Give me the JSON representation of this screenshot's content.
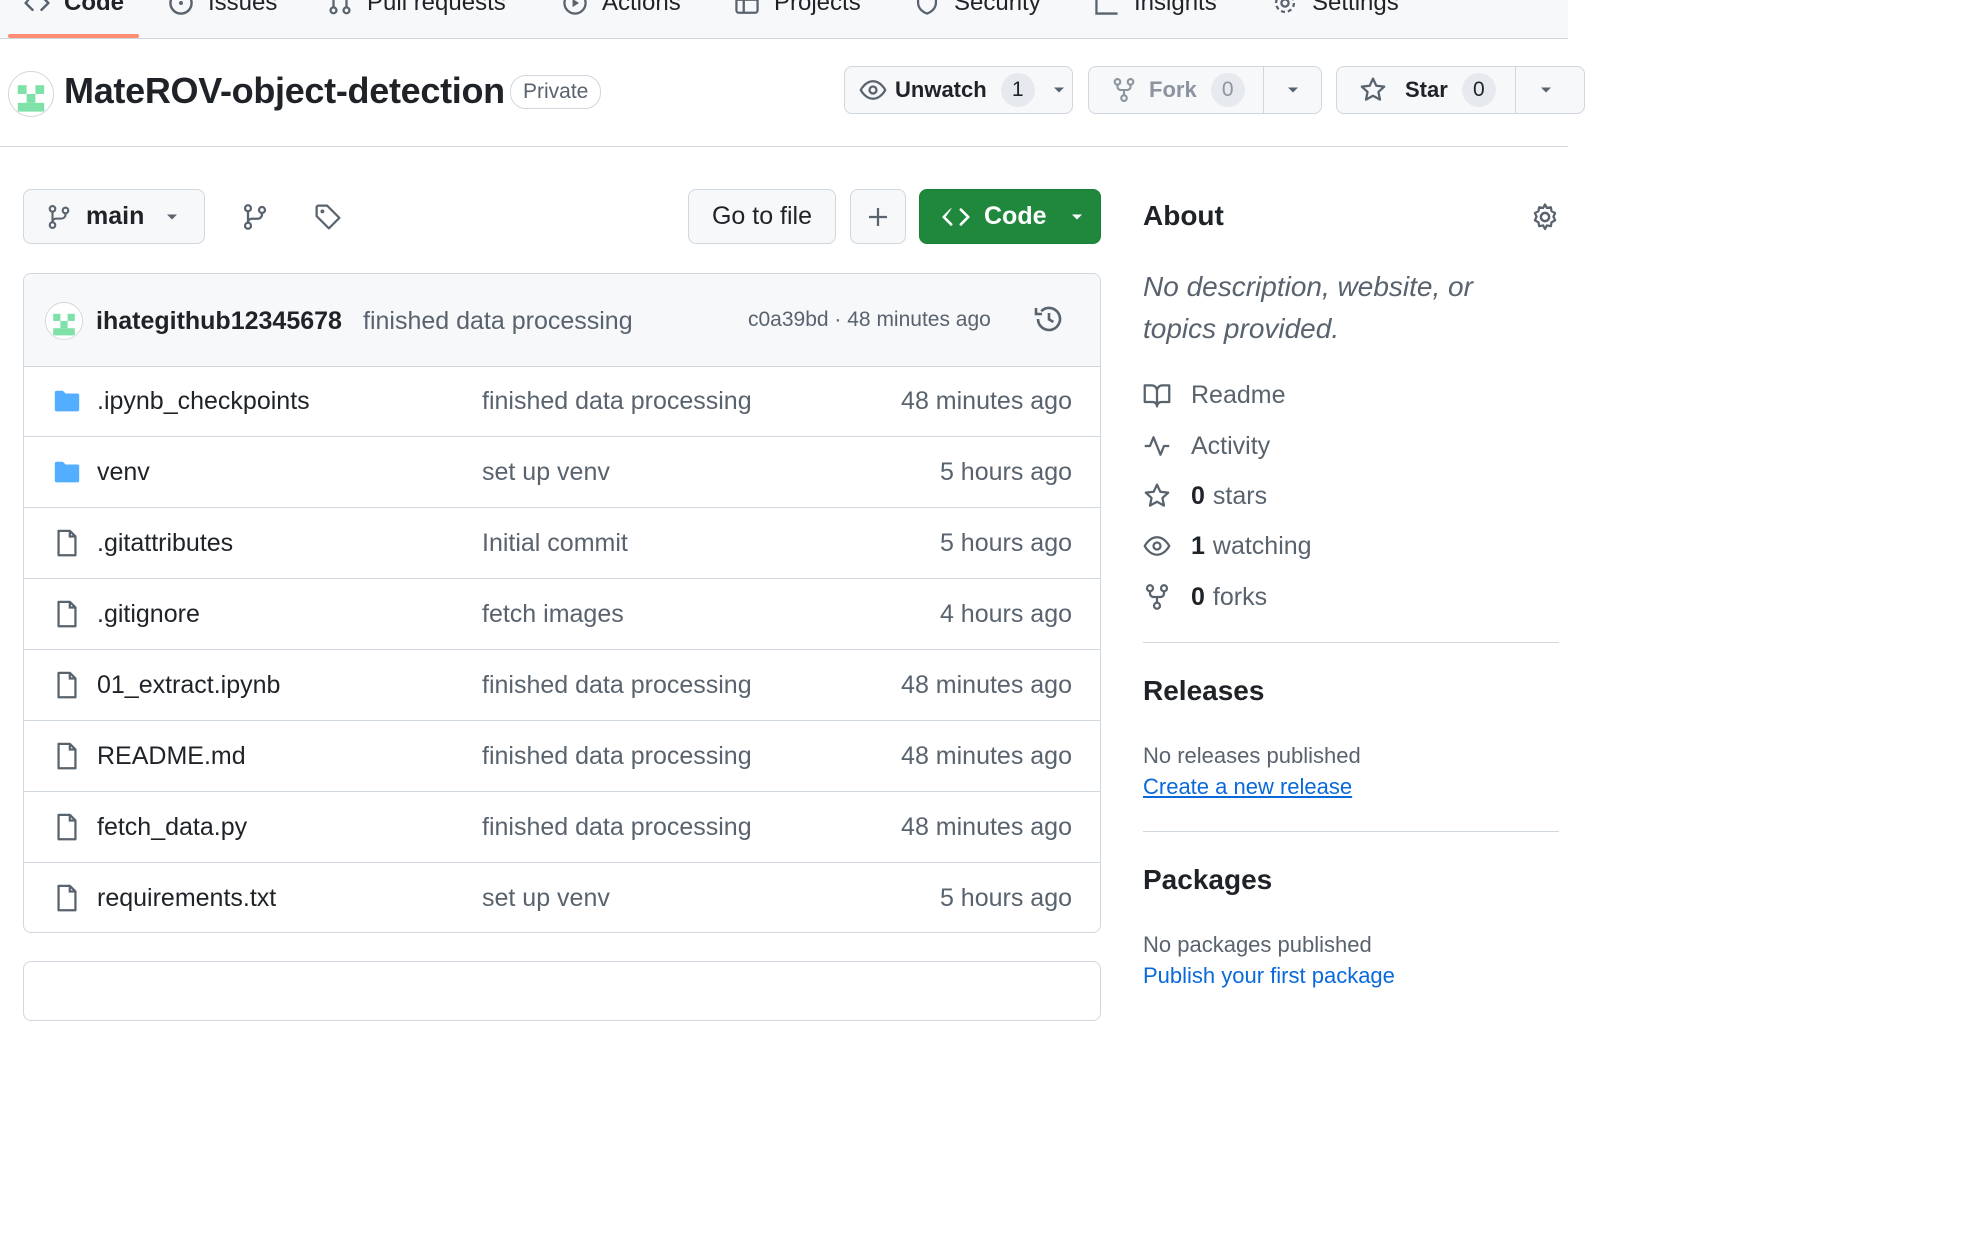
{
  "nav": {
    "tabs": [
      {
        "label": "Code",
        "icon": "code-icon"
      },
      {
        "label": "Issues",
        "icon": "issue-icon"
      },
      {
        "label": "Pull requests",
        "icon": "pull-request-icon"
      },
      {
        "label": "Actions",
        "icon": "play-icon"
      },
      {
        "label": "Projects",
        "icon": "table-icon"
      },
      {
        "label": "Security",
        "icon": "shield-icon"
      },
      {
        "label": "Insights",
        "icon": "graph-icon"
      },
      {
        "label": "Settings",
        "icon": "gear-icon"
      }
    ],
    "active_tab": "Code",
    "active_color": "#fd8c73"
  },
  "repo": {
    "name": "MateROV-object-detection",
    "visibility": "Private",
    "unwatch_label": "Unwatch",
    "watch_count": "1",
    "fork_label": "Fork",
    "fork_count": "0",
    "star_label": "Star",
    "star_count": "0"
  },
  "toolbar": {
    "branch": "main",
    "go_to_file": "Go to file",
    "add_label": "+",
    "code_label": "Code",
    "code_button_color": "#1f883d"
  },
  "latest_commit": {
    "author": "ihategithub12345678",
    "message": "finished data processing",
    "hash": "c0a39bd",
    "time": "48 minutes ago"
  },
  "files": [
    {
      "type": "folder",
      "name": ".ipynb_checkpoints",
      "message": "finished data processing",
      "time": "48 minutes ago"
    },
    {
      "type": "folder",
      "name": "venv",
      "message": "set up venv",
      "time": "5 hours ago"
    },
    {
      "type": "file",
      "name": ".gitattributes",
      "message": "Initial commit",
      "time": "5 hours ago"
    },
    {
      "type": "file",
      "name": ".gitignore",
      "message": "fetch images",
      "time": "4 hours ago"
    },
    {
      "type": "file",
      "name": "01_extract.ipynb",
      "message": "finished data processing",
      "time": "48 minutes ago"
    },
    {
      "type": "file",
      "name": "README.md",
      "message": "finished data processing",
      "time": "48 minutes ago"
    },
    {
      "type": "file",
      "name": "fetch_data.py",
      "message": "finished data processing",
      "time": "48 minutes ago"
    },
    {
      "type": "file",
      "name": "requirements.txt",
      "message": "set up venv",
      "time": "5 hours ago"
    }
  ],
  "about": {
    "title": "About",
    "description": "No description, website, or topics provided.",
    "readme": "Readme",
    "activity": "Activity",
    "stars_count": "0",
    "stars_label": "stars",
    "watching_count": "1",
    "watching_label": "watching",
    "forks_count": "0",
    "forks_label": "forks"
  },
  "releases": {
    "title": "Releases",
    "empty_text": "No releases published",
    "create_link": "Create a new release"
  },
  "packages": {
    "title": "Packages",
    "empty_text": "No packages published",
    "publish_link": "Publish your first package"
  },
  "colors": {
    "link": "#0969da",
    "folder": "#54aeff",
    "avatar": "#7ee2a8"
  }
}
